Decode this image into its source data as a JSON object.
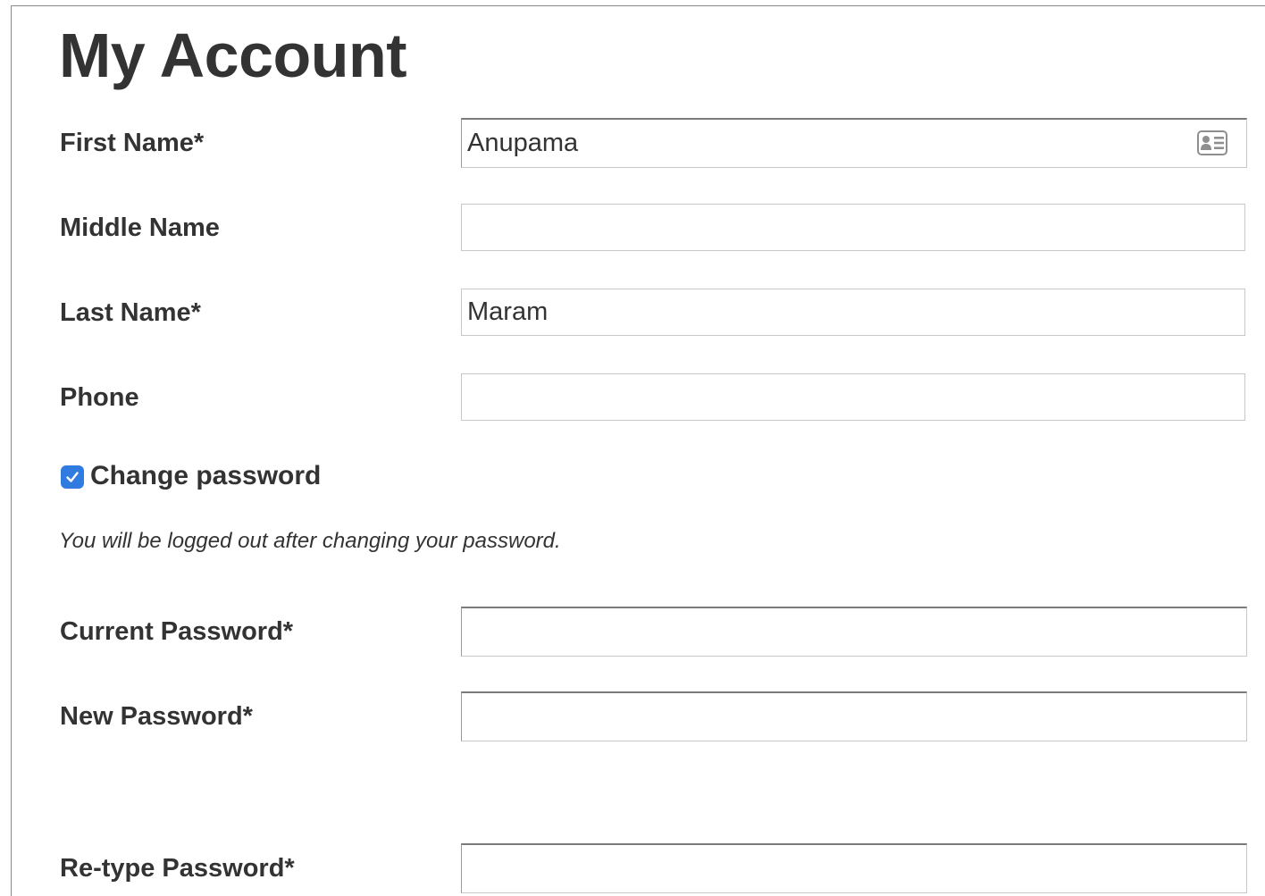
{
  "page": {
    "title": "My Account"
  },
  "fields": {
    "first_name": {
      "label": "First Name*",
      "value": "Anupama"
    },
    "middle_name": {
      "label": "Middle Name",
      "value": ""
    },
    "last_name": {
      "label": "Last Name*",
      "value": "Maram"
    },
    "phone": {
      "label": "Phone",
      "value": ""
    }
  },
  "change_password": {
    "label": "Change password",
    "checked": true,
    "note": "You will be logged out after changing your password."
  },
  "password_fields": {
    "current": {
      "label": "Current Password*",
      "value": ""
    },
    "new": {
      "label": "New Password*",
      "value": ""
    },
    "retype": {
      "label": "Re-type Password*",
      "value": ""
    }
  },
  "icons": {
    "autofill": "contact-card-icon",
    "check": "checkmark-icon"
  },
  "colors": {
    "checkbox": "#2f7be0",
    "text": "#333333"
  }
}
